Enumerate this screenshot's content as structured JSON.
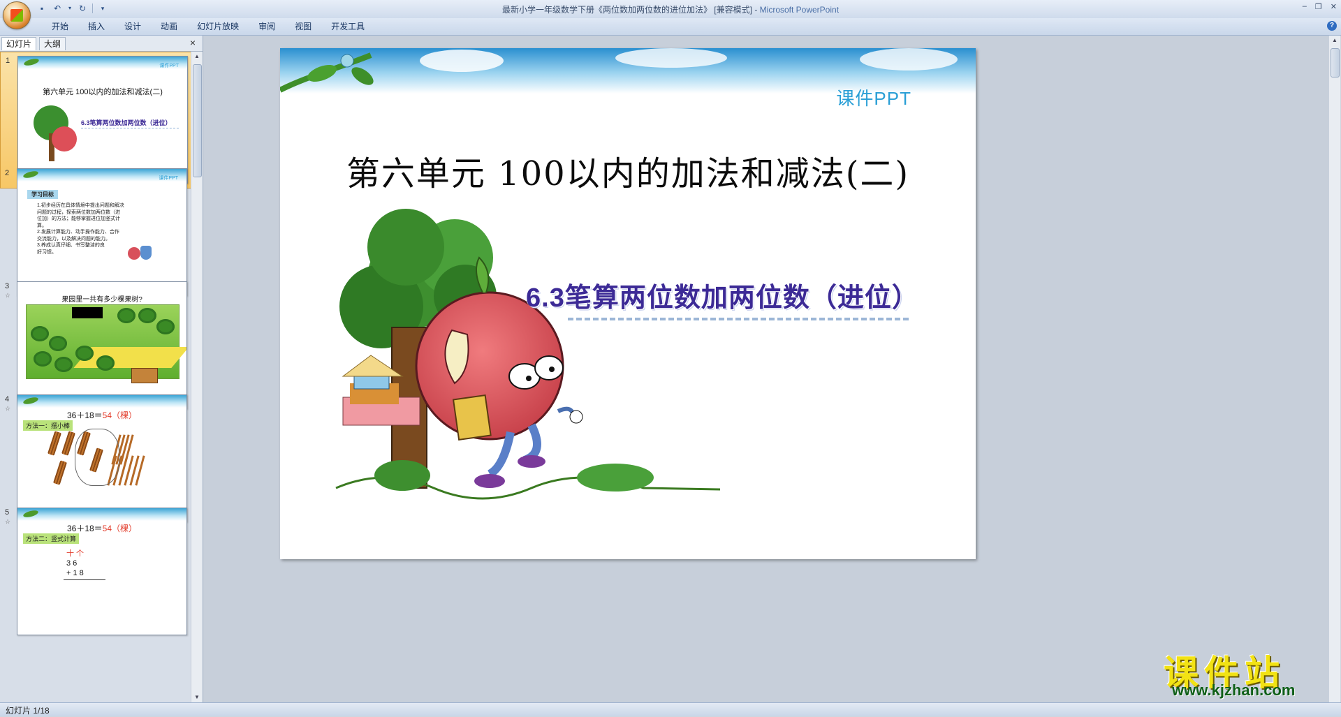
{
  "window": {
    "title": "最新小学一年级数学下册《两位数加两位数的进位加法》 [兼容模式]",
    "title_sep": " - ",
    "app_name": "Microsoft PowerPoint"
  },
  "ribbon": {
    "tabs": [
      "开始",
      "插入",
      "设计",
      "动画",
      "幻灯片放映",
      "审阅",
      "视图",
      "开发工具"
    ]
  },
  "panel": {
    "tab_slides": "幻灯片",
    "tab_outline": "大纲",
    "close": "×"
  },
  "thumbnails": {
    "s1": {
      "num": "1",
      "title": "第六单元 100以内的加法和减法(二)",
      "sub": "6.3笔算两位数加两位数（进位）",
      "kj": "课件PPT"
    },
    "s2": {
      "num": "2",
      "label": "学习目标",
      "kj": "课件PPT",
      "text": "1.初步经历在具体情境中提出问题和解决\n问题的过程，探索两位数加两位数（进\n位加）的方法；能够掌握进位加竖式计\n算。\n2.发展计算能力、动手操作能力、合作\n交流能力，以及解决问题的能力。\n3.养成认真仔细、书写整洁的良\n好习惯。"
    },
    "s3": {
      "num": "3",
      "star": "☆",
      "title": "果园里一共有多少棵果树?"
    },
    "s4": {
      "num": "4",
      "star": "☆",
      "eq": "36＋18＝",
      "ans": "54（棵）",
      "method": "方法一：摆小棒"
    },
    "s5": {
      "num": "5",
      "star": "☆",
      "eq": "36＋18＝",
      "ans": "54（棵）",
      "method": "方法二：竖式计算",
      "digits_head": "十 个",
      "row1": "3 6",
      "row2": "+ 1 8"
    }
  },
  "slide": {
    "title": "第六单元 100以内的加法和减法(二)",
    "subtitle": "6.3笔算两位数加两位数（进位）",
    "brand": "课件PPT"
  },
  "status": {
    "text": "幻灯片 1/18"
  },
  "watermark": {
    "line1": "课件站",
    "line2": "www.kjzhan.com"
  },
  "icons": {
    "office": "office-logo-icon",
    "save": "save-icon",
    "undo": "undo-icon",
    "redo": "redo-icon",
    "help": "help-icon"
  },
  "colors": {
    "subtitle": "#3c2a96",
    "brand": "#2a9fd6",
    "answer": "#e23b2a",
    "watermark": "#f2e214"
  }
}
